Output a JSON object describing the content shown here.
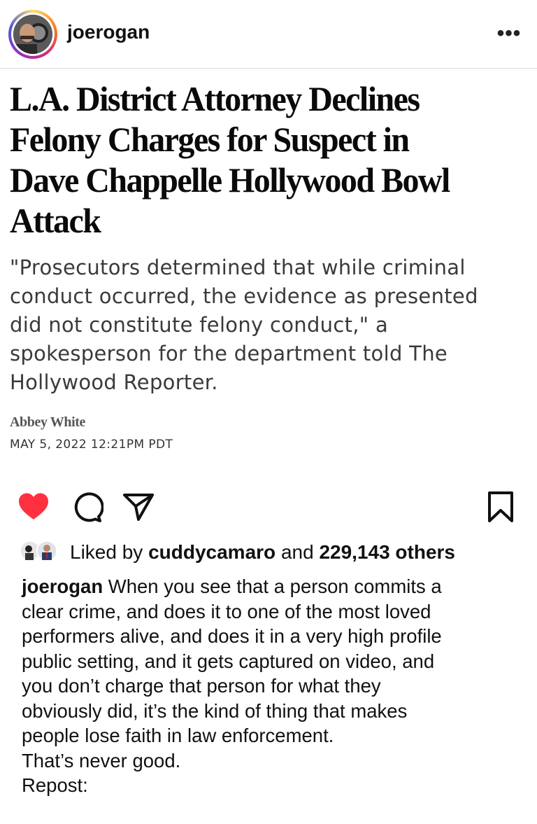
{
  "header": {
    "username": "joerogan",
    "more_label": "•••",
    "avatar_icon": "profile-avatar"
  },
  "article": {
    "headline_lines": [
      "L.A. District Attorney Declines",
      "Felony Charges for Suspect in",
      "Dave Chappelle Hollywood Bowl",
      "Attack"
    ],
    "dek_lines": [
      "\"Prosecutors determined that while criminal",
      "conduct occurred, the evidence as presented",
      "did not constitute felony conduct,\" a",
      "spokesperson for the department told The",
      "Hollywood Reporter."
    ],
    "author": "Abbey White",
    "date": "MAY 5, 2022 12:21PM PDT"
  },
  "actions": {
    "like_icon": "heart-filled-icon",
    "comment_icon": "comment-icon",
    "share_icon": "paper-plane-icon",
    "save_icon": "bookmark-icon",
    "like_color": "#ff3040"
  },
  "likes": {
    "prefix": "Liked by",
    "user": "cuddycamaro",
    "conjunction": "and",
    "count": "229,143 others"
  },
  "caption": {
    "username": "joerogan",
    "lines": [
      "When you see that a person commits a",
      "clear crime, and does it to one of the most loved",
      "performers alive, and does it in a very high profile",
      "public setting, and it gets captured on video, and",
      "you don’t charge that person for what they",
      "obviously did, it’s the kind of thing that makes",
      "people lose faith in law enforcement.",
      "That’s never good.",
      "Repost:"
    ]
  }
}
